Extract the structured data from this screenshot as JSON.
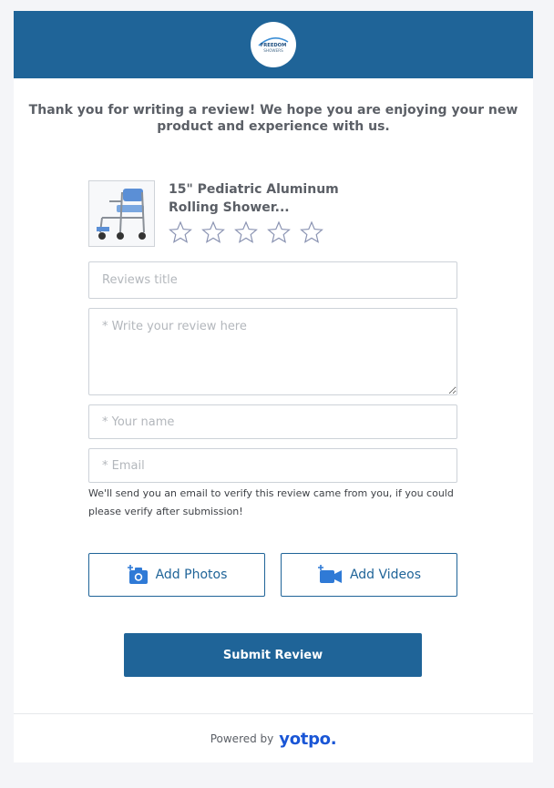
{
  "header": {
    "logo_line1": "FREEDOM",
    "logo_line2": "SHOWERS",
    "bg_color": "#1f6498"
  },
  "intro_text": "Thank you for writing a review! We hope you are enjoying your new product and experience with us.",
  "product": {
    "title": "15\" Pediatric Aluminum Rolling Shower...",
    "thumbnail_icon": "shower-chair-image",
    "rating": {
      "value": 0,
      "max": 5
    }
  },
  "form": {
    "title_placeholder": "Reviews title",
    "review_placeholder": "* Write your review here",
    "name_placeholder": "* Your name",
    "email_placeholder": "* Email",
    "verify_note": "We'll send you an email to verify this review came from you, if you could please verify after submission!"
  },
  "media": {
    "photos_label": "Add Photos",
    "photos_icon": "add-camera-icon",
    "videos_label": "Add Videos",
    "videos_icon": "add-video-icon"
  },
  "submit_label": "Submit Review",
  "footer": {
    "powered_by": "Powered by",
    "brand": "yotpo."
  },
  "colors": {
    "accent": "#1f6498",
    "yotpo_brand": "#1a56d6",
    "star_outline": "#8a93b2"
  }
}
